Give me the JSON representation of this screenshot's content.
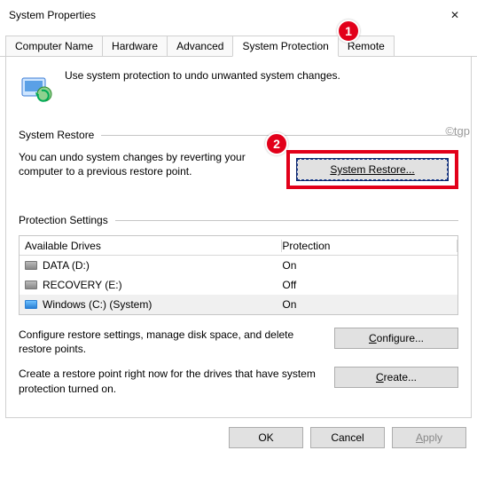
{
  "window": {
    "title": "System Properties"
  },
  "tabs": {
    "computer_name": "Computer Name",
    "hardware": "Hardware",
    "advanced": "Advanced",
    "system_protection": "System Protection",
    "remote": "Remote"
  },
  "intro": "Use system protection to undo unwanted system changes.",
  "sections": {
    "restore_title": "System Restore",
    "protection_title": "Protection Settings"
  },
  "restore": {
    "text": "You can undo system changes by reverting your computer to a previous restore point.",
    "button": "System Restore..."
  },
  "drives": {
    "head_drive": "Available Drives",
    "head_prot": "Protection",
    "rows": [
      {
        "name": "DATA (D:)",
        "prot": "On",
        "sys": false
      },
      {
        "name": "RECOVERY (E:)",
        "prot": "Off",
        "sys": false
      },
      {
        "name": "Windows (C:) (System)",
        "prot": "On",
        "sys": true
      }
    ]
  },
  "configure": {
    "text": "Configure restore settings, manage disk space, and delete restore points.",
    "button_prefix": "C",
    "button_rest": "onfigure..."
  },
  "create": {
    "text": "Create a restore point right now for the drives that have system protection turned on.",
    "button_prefix": "C",
    "button_rest": "reate..."
  },
  "footer": {
    "ok": "OK",
    "cancel": "Cancel",
    "apply_prefix": "A",
    "apply_rest": "pply"
  },
  "annotations": {
    "watermark": "©tgp",
    "badge1": "1",
    "badge2": "2"
  }
}
